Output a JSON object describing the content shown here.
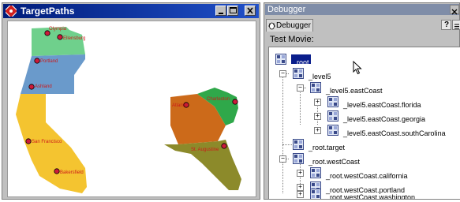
{
  "left_window": {
    "title": "TargetPaths",
    "cities": [
      {
        "name": "Olympia"
      },
      {
        "name": "Ellensburg"
      },
      {
        "name": "Portland"
      },
      {
        "name": "Ashland"
      },
      {
        "name": "San Francisco"
      },
      {
        "name": "Bakersfield"
      },
      {
        "name": "Charleston"
      },
      {
        "name": "Atlanta"
      },
      {
        "name": "St. Augustine"
      }
    ],
    "colors": {
      "washington": "#6fd08c",
      "oregon": "#6a9acb",
      "california": "#f4c430",
      "georgia": "#cc6a1a",
      "south_carolina": "#2fa84a",
      "florida": "#8c8a2a",
      "city_marker": "#cc1a3a"
    }
  },
  "right_window": {
    "title": "Debugger",
    "tab_label": "Debugger",
    "movie_label": "Test Movie:",
    "help_label": "?",
    "tree": [
      {
        "label": "_root",
        "selected": true
      },
      {
        "label": "_level5"
      },
      {
        "label": "_level5.eastCoast"
      },
      {
        "label": "_level5.eastCoast.florida"
      },
      {
        "label": "_level5.eastCoast.georgia"
      },
      {
        "label": "_level5.eastCoast.southCarolina"
      },
      {
        "label": "_root.target"
      },
      {
        "label": "_root.westCoast"
      },
      {
        "label": "_root.westCoast.california"
      },
      {
        "label": "_root.westCoast.portland"
      },
      {
        "label": "_root.westCoast.washington"
      }
    ]
  }
}
